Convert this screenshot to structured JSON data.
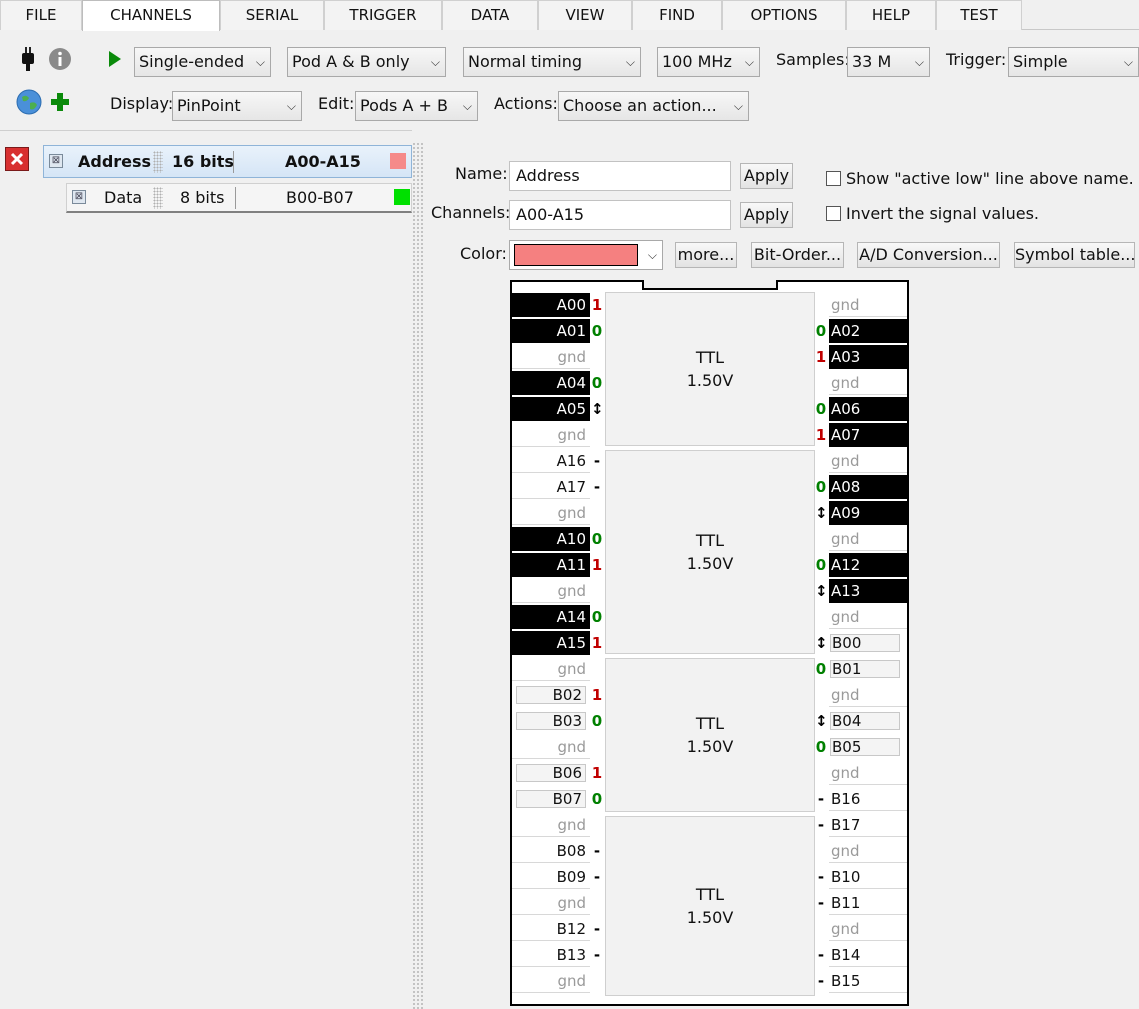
{
  "menu": {
    "tabs": [
      {
        "label": "FILE"
      },
      {
        "label": "CHANNELS"
      },
      {
        "label": "SERIAL"
      },
      {
        "label": "TRIGGER"
      },
      {
        "label": "DATA"
      },
      {
        "label": "VIEW"
      },
      {
        "label": "FIND"
      },
      {
        "label": "OPTIONS"
      },
      {
        "label": "HELP"
      },
      {
        "label": "TEST"
      }
    ],
    "active": "CHANNELS"
  },
  "toolbar": {
    "mode": "Single-ended",
    "pods": "Pod A & B only",
    "timing": "Normal timing",
    "rate": "100 MHz",
    "samples_label": "Samples:",
    "samples": "33 M",
    "trigger_label": "Trigger:",
    "trigger": "Simple",
    "display_label": "Display:",
    "display": "PinPoint",
    "edit_label": "Edit:",
    "edit": "Pods A + B",
    "actions_label": "Actions:",
    "actions": "Choose an action...",
    "icons": [
      "usb-plug-icon",
      "info-icon",
      "run-icon",
      "globe-icon",
      "add-icon"
    ],
    "colors": {
      "run": "#0a8a0a",
      "add": "#0a8a0a"
    }
  },
  "groups": [
    {
      "name": "Address",
      "bits": "16 bits",
      "range": "A00-A15",
      "color": "#f58a8a"
    },
    {
      "name": "Data",
      "bits": "8 bits",
      "range": "B00-B07",
      "color": "#00e000"
    }
  ],
  "editor": {
    "name_label": "Name:",
    "name_value": "Address",
    "channels_label": "Channels:",
    "channels_value": "A00-A15",
    "apply": "Apply",
    "active_low": "Show \"active low\" line above name.",
    "invert": "Invert the signal values.",
    "color_label": "Color:",
    "color_value": "#f58080",
    "more": "more...",
    "bit_order": "Bit-Order...",
    "ad_conv": "A/D Conversion...",
    "symbol_table": "Symbol table..."
  },
  "pods": [
    {
      "logic": "TTL",
      "voltage": "1.50V"
    },
    {
      "logic": "TTL",
      "voltage": "1.50V"
    },
    {
      "logic": "TTL",
      "voltage": "1.50V"
    },
    {
      "logic": "TTL",
      "voltage": "1.50V"
    }
  ],
  "pins_left": [
    {
      "label": "A00",
      "state": "1",
      "style": "black"
    },
    {
      "label": "A01",
      "state": "0",
      "style": "black"
    },
    {
      "label": "gnd",
      "state": "",
      "style": "gnd"
    },
    {
      "label": "A04",
      "state": "0",
      "style": "black"
    },
    {
      "label": "A05",
      "state": "↕",
      "style": "black"
    },
    {
      "label": "gnd",
      "state": "",
      "style": "gnd"
    },
    {
      "label": "A16",
      "state": "-",
      "style": "plain"
    },
    {
      "label": "A17",
      "state": "-",
      "style": "plain"
    },
    {
      "label": "gnd",
      "state": "",
      "style": "gnd"
    },
    {
      "label": "A10",
      "state": "0",
      "style": "black"
    },
    {
      "label": "A11",
      "state": "1",
      "style": "black"
    },
    {
      "label": "gnd",
      "state": "",
      "style": "gnd"
    },
    {
      "label": "A14",
      "state": "0",
      "style": "black"
    },
    {
      "label": "A15",
      "state": "1",
      "style": "black"
    },
    {
      "label": "gnd",
      "state": "",
      "style": "gnd"
    },
    {
      "label": "B02",
      "state": "1",
      "style": "grey"
    },
    {
      "label": "B03",
      "state": "0",
      "style": "grey"
    },
    {
      "label": "gnd",
      "state": "",
      "style": "gnd"
    },
    {
      "label": "B06",
      "state": "1",
      "style": "grey"
    },
    {
      "label": "B07",
      "state": "0",
      "style": "grey"
    },
    {
      "label": "gnd",
      "state": "",
      "style": "gnd"
    },
    {
      "label": "B08",
      "state": "-",
      "style": "plain"
    },
    {
      "label": "B09",
      "state": "-",
      "style": "plain"
    },
    {
      "label": "gnd",
      "state": "",
      "style": "gnd"
    },
    {
      "label": "B12",
      "state": "-",
      "style": "plain"
    },
    {
      "label": "B13",
      "state": "-",
      "style": "plain"
    },
    {
      "label": "gnd",
      "state": "",
      "style": "gnd"
    }
  ],
  "pins_right": [
    {
      "label": "gnd",
      "state": "",
      "style": "gnd"
    },
    {
      "label": "A02",
      "state": "0",
      "style": "black"
    },
    {
      "label": "A03",
      "state": "1",
      "style": "black"
    },
    {
      "label": "gnd",
      "state": "",
      "style": "gnd"
    },
    {
      "label": "A06",
      "state": "0",
      "style": "black"
    },
    {
      "label": "A07",
      "state": "1",
      "style": "black"
    },
    {
      "label": "gnd",
      "state": "",
      "style": "gnd"
    },
    {
      "label": "A08",
      "state": "0",
      "style": "black"
    },
    {
      "label": "A09",
      "state": "↕",
      "style": "black"
    },
    {
      "label": "gnd",
      "state": "",
      "style": "gnd"
    },
    {
      "label": "A12",
      "state": "0",
      "style": "black"
    },
    {
      "label": "A13",
      "state": "↕",
      "style": "black"
    },
    {
      "label": "gnd",
      "state": "",
      "style": "gnd"
    },
    {
      "label": "B00",
      "state": "↕",
      "style": "grey"
    },
    {
      "label": "B01",
      "state": "0",
      "style": "grey"
    },
    {
      "label": "gnd",
      "state": "",
      "style": "gnd"
    },
    {
      "label": "B04",
      "state": "↕",
      "style": "grey"
    },
    {
      "label": "B05",
      "state": "0",
      "style": "grey"
    },
    {
      "label": "gnd",
      "state": "",
      "style": "gnd"
    },
    {
      "label": "B16",
      "state": "-",
      "style": "plain"
    },
    {
      "label": "B17",
      "state": "-",
      "style": "plain"
    },
    {
      "label": "gnd",
      "state": "",
      "style": "gnd"
    },
    {
      "label": "B10",
      "state": "-",
      "style": "plain"
    },
    {
      "label": "B11",
      "state": "-",
      "style": "plain"
    },
    {
      "label": "gnd",
      "state": "",
      "style": "gnd"
    },
    {
      "label": "B14",
      "state": "-",
      "style": "plain"
    },
    {
      "label": "B15",
      "state": "-",
      "style": "plain"
    }
  ],
  "state_colors": {
    "1": "#c00000",
    "0": "#008000",
    "↕": "#000000",
    "-": "#000000"
  }
}
